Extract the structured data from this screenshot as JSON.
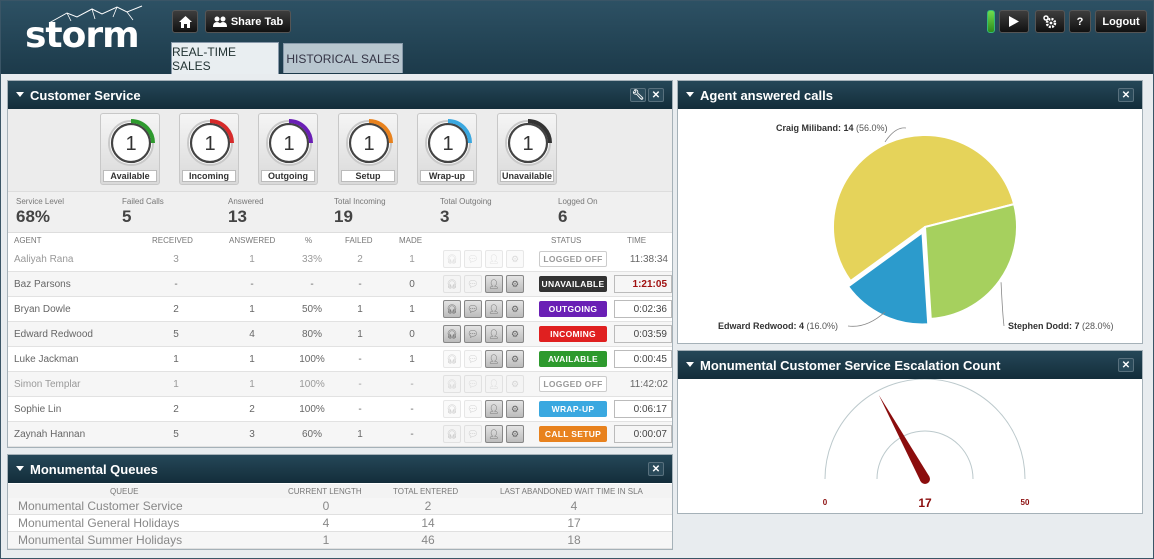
{
  "header": {
    "logo_text": "storm",
    "share_label": "Share Tab",
    "logout_label": "Logout",
    "help_label": "?",
    "tabs": [
      {
        "label": "REAL-TIME SALES",
        "active": true
      },
      {
        "label": "HISTORICAL SALES",
        "active": false
      }
    ]
  },
  "customer_service": {
    "title": "Customer Service",
    "states": [
      {
        "label": "Available",
        "value": "1",
        "color": "#2e9a2e"
      },
      {
        "label": "Incoming",
        "value": "1",
        "color": "#d62a2a"
      },
      {
        "label": "Outgoing",
        "value": "1",
        "color": "#6a1fb5"
      },
      {
        "label": "Setup",
        "value": "1",
        "color": "#e8821e"
      },
      {
        "label": "Wrap-up",
        "value": "1",
        "color": "#3aa8e0"
      },
      {
        "label": "Unavailable",
        "value": "1",
        "color": "#333333"
      }
    ],
    "stats": [
      {
        "label": "Service Level",
        "value": "68%"
      },
      {
        "label": "Failed Calls",
        "value": "5"
      },
      {
        "label": "Answered",
        "value": "13"
      },
      {
        "label": "Total Incoming",
        "value": "19"
      },
      {
        "label": "Total Outgoing",
        "value": "3"
      },
      {
        "label": "Logged On",
        "value": "6"
      }
    ],
    "columns": {
      "agent": "Agent",
      "received": "Received",
      "answered": "Answered",
      "pct": "%",
      "failed": "Failed",
      "made": "Made",
      "status": "Status",
      "time": "Time"
    },
    "agents": [
      {
        "name": "Aaliyah Rana",
        "received": "3",
        "answered": "1",
        "pct": "33%",
        "failed": "2",
        "made": "1",
        "status": "LOGGED OFF",
        "status_color": "#ffffff",
        "time": "11:38:34",
        "active": false
      },
      {
        "name": "Baz Parsons",
        "received": "-",
        "answered": "-",
        "pct": "-",
        "failed": "-",
        "made": "0",
        "status": "UNAVAILABLE",
        "status_color": "#333333",
        "time": "1:21:05",
        "active": true,
        "alert": true
      },
      {
        "name": "Bryan Dowle",
        "received": "2",
        "answered": "1",
        "pct": "50%",
        "failed": "1",
        "made": "1",
        "status": "OUTGOING",
        "status_color": "#6a1fb5",
        "time": "0:02:36",
        "active": true
      },
      {
        "name": "Edward Redwood",
        "received": "5",
        "answered": "4",
        "pct": "80%",
        "failed": "1",
        "made": "0",
        "status": "INCOMING",
        "status_color": "#e02020",
        "time": "0:03:59",
        "active": true
      },
      {
        "name": "Luke Jackman",
        "received": "1",
        "answered": "1",
        "pct": "100%",
        "failed": "-",
        "made": "1",
        "status": "AVAILABLE",
        "status_color": "#2e9a2e",
        "time": "0:00:45",
        "active": true
      },
      {
        "name": "Simon Templar",
        "received": "1",
        "answered": "1",
        "pct": "100%",
        "failed": "-",
        "made": "-",
        "status": "LOGGED OFF",
        "status_color": "#ffffff",
        "time": "11:42:02",
        "active": false
      },
      {
        "name": "Sophie Lin",
        "received": "2",
        "answered": "2",
        "pct": "100%",
        "failed": "-",
        "made": "-",
        "status": "WRAP-UP",
        "status_color": "#3aa8e0",
        "time": "0:06:17",
        "active": true
      },
      {
        "name": "Zaynah Hannan",
        "received": "5",
        "answered": "3",
        "pct": "60%",
        "failed": "1",
        "made": "-",
        "status": "CALL SETUP",
        "status_color": "#e8821e",
        "time": "0:00:07",
        "active": true
      }
    ]
  },
  "queues": {
    "title": "Monumental Queues",
    "columns": {
      "queue": "Queue",
      "length": "Current Length",
      "entered": "Total Entered",
      "wait": "Last Abandoned Wait Time in SLA"
    },
    "rows": [
      {
        "name": "Monumental Customer Service",
        "length": "0",
        "entered": "2",
        "wait": "4"
      },
      {
        "name": "Monumental General Holidays",
        "length": "4",
        "entered": "14",
        "wait": "17"
      },
      {
        "name": "Monumental Summer Holidays",
        "length": "1",
        "entered": "46",
        "wait": "18"
      }
    ]
  },
  "agent_calls": {
    "title": "Agent answered calls",
    "chart_data": {
      "type": "pie",
      "title": "",
      "slices": [
        {
          "name": "Craig Miliband",
          "value": 14,
          "pct": "(56.0%)",
          "color": "#e5d35a"
        },
        {
          "name": "Stephen Dodd",
          "value": 7,
          "pct": "(28.0%)",
          "color": "#a6d05e"
        },
        {
          "name": "Edward Redwood",
          "value": 4,
          "pct": "(16.0%)",
          "color": "#2c9bcc"
        }
      ]
    }
  },
  "escalation": {
    "title": "Monumental Customer Service Escalation Count",
    "chart_data": {
      "type": "gauge",
      "min": 0,
      "max": 50,
      "value": 17,
      "min_label": "0",
      "max_label": "50",
      "value_label": "17"
    }
  }
}
